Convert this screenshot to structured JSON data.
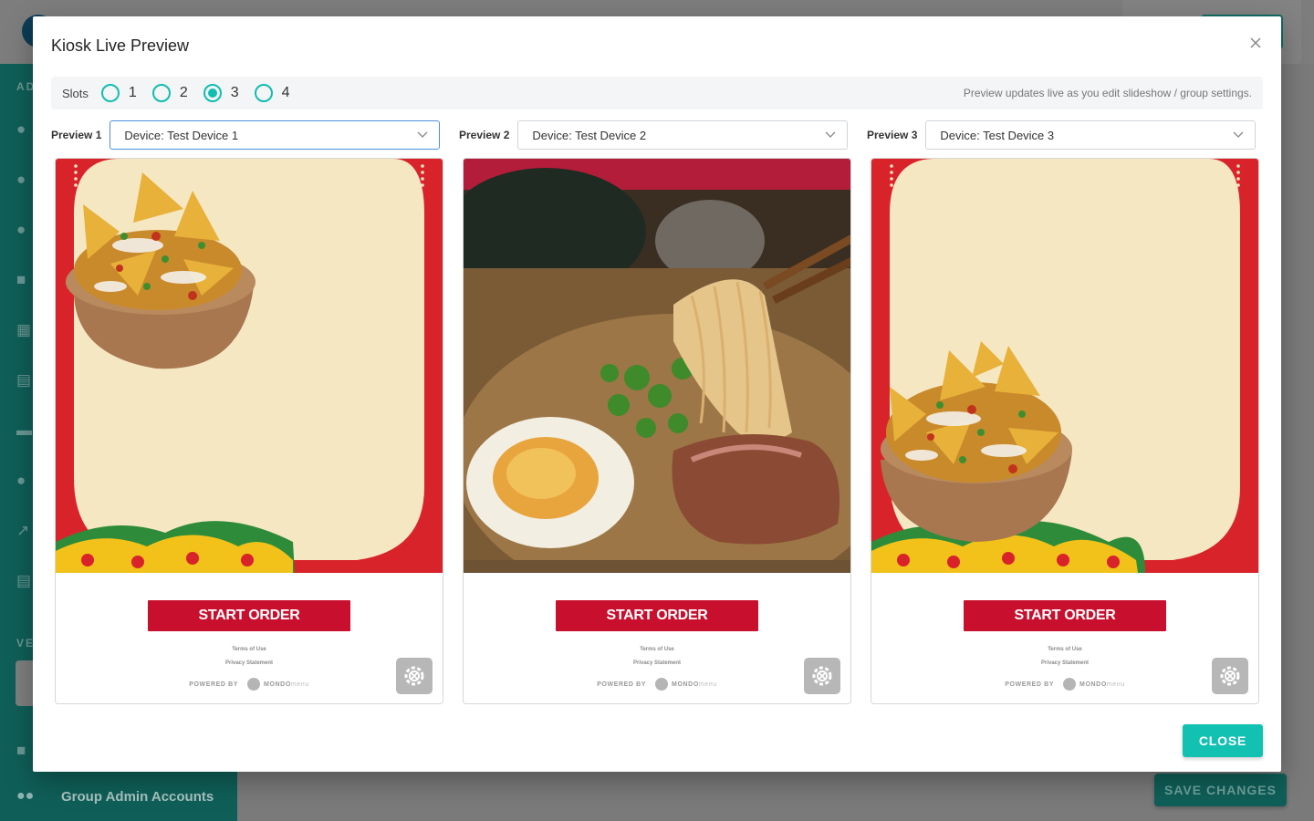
{
  "background": {
    "sidebar_sections": [
      "AD",
      "VE"
    ],
    "sidebar_group_item": "Group Admin Accounts",
    "save_changes_label": "SAVE CHANGES"
  },
  "modal": {
    "title": "Kiosk Live Preview",
    "close_icon": "close-icon",
    "slots": {
      "label": "Slots",
      "options": [
        "1",
        "2",
        "3",
        "4"
      ],
      "selected": "3",
      "hint": "Preview updates live as you edit slideshow / group settings."
    },
    "previews": [
      {
        "label": "Preview 1",
        "device": "Device: Test Device 1",
        "image": "nachos-bowl-top-left"
      },
      {
        "label": "Preview 2",
        "device": "Device: Test Device 2",
        "image": "ramen-bowl-photo"
      },
      {
        "label": "Preview 3",
        "device": "Device: Test Device 3",
        "image": "nachos-bowl-center-left"
      }
    ],
    "kiosk": {
      "start_label": "START ORDER",
      "terms": "Terms of Use",
      "privacy": "Privacy Statement",
      "powered_by": "POWERED BY",
      "brand_bold": "MONDO",
      "brand_light": "menu",
      "gear_icon": "settings-gear-icon"
    },
    "close_label": "CLOSE"
  },
  "colors": {
    "accent": "#13c1b3",
    "kiosk_red": "#c8102e",
    "kiosk_cream": "#f6e7c3",
    "frame_red": "#d9232b"
  }
}
